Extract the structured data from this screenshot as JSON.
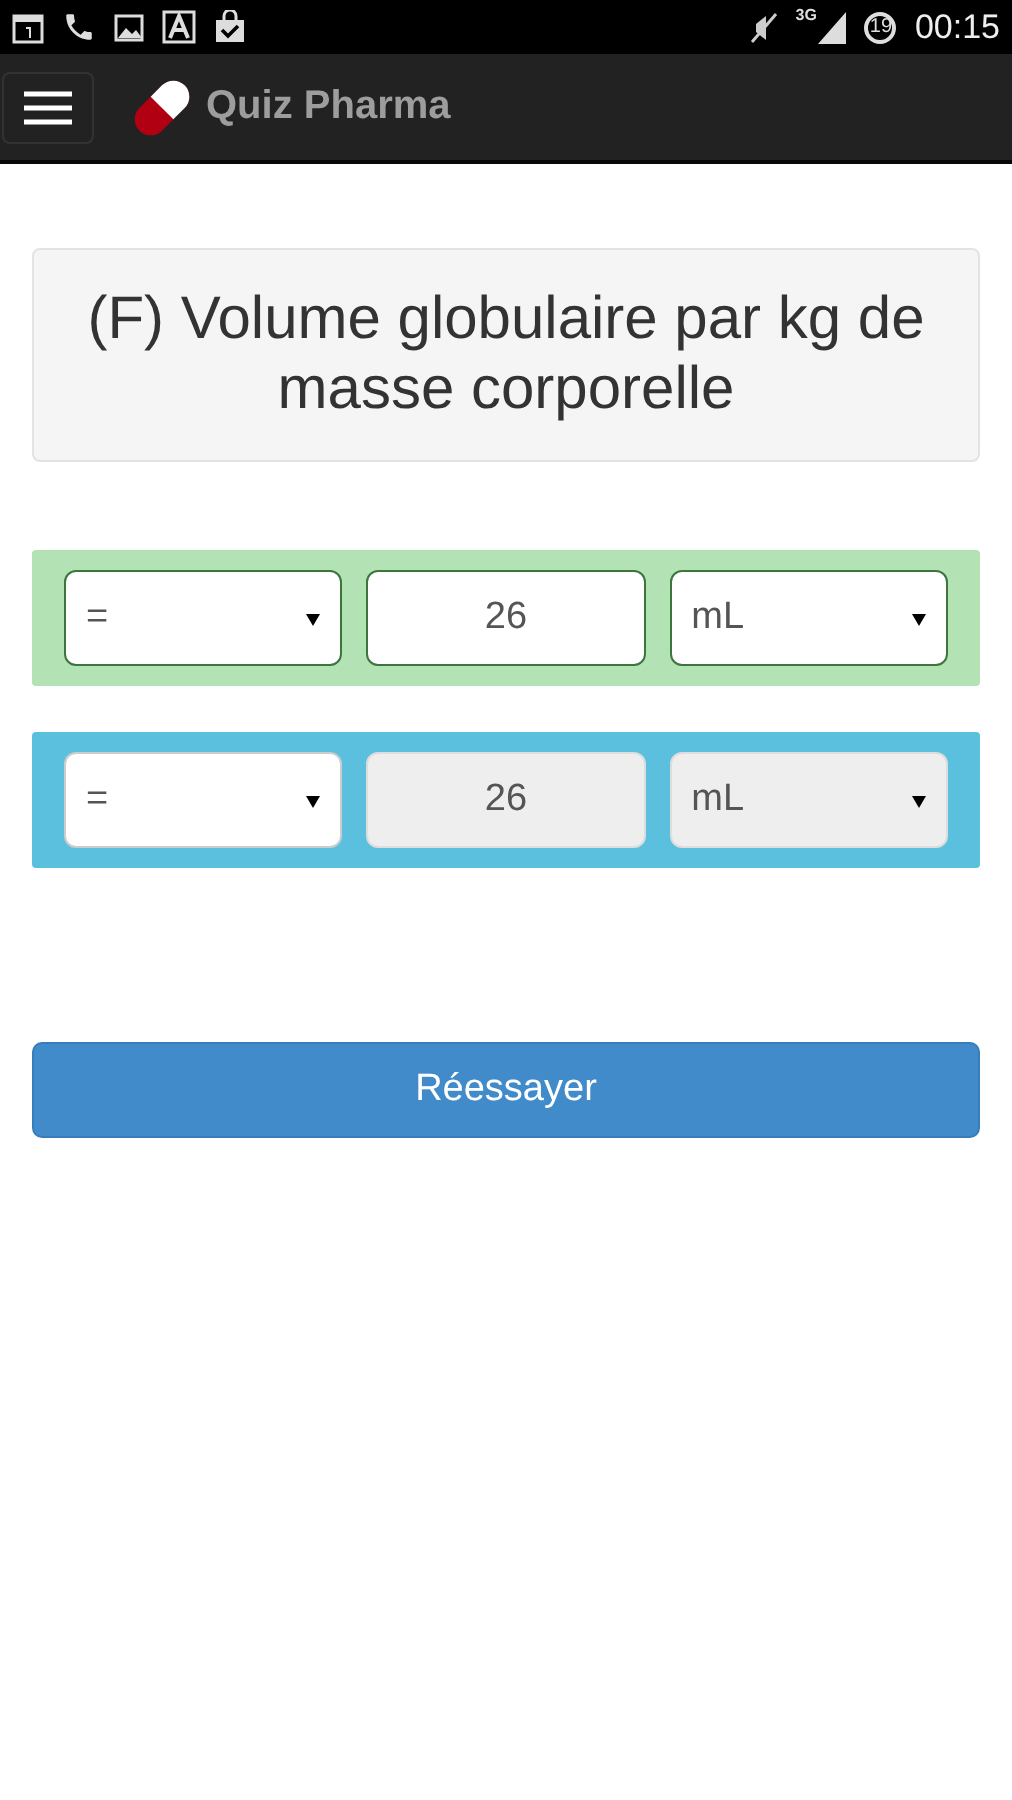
{
  "status_bar": {
    "network": "3G",
    "battery": "19",
    "time": "00:15"
  },
  "app_bar": {
    "title": "Quiz Pharma"
  },
  "question": "(F) Volume globulaire par kg de masse corporelle",
  "answers": [
    {
      "kind": "given",
      "operator": {
        "value": "=",
        "disabled": false
      },
      "amount": {
        "value": "26",
        "disabled": false
      },
      "unit": {
        "value": "mL",
        "disabled": false
      }
    },
    {
      "kind": "solution",
      "operator": {
        "value": "=",
        "disabled": false
      },
      "amount": {
        "value": "26",
        "disabled": true
      },
      "unit": {
        "value": "mL",
        "disabled": true
      }
    }
  ],
  "retry_button": "Réessayer"
}
